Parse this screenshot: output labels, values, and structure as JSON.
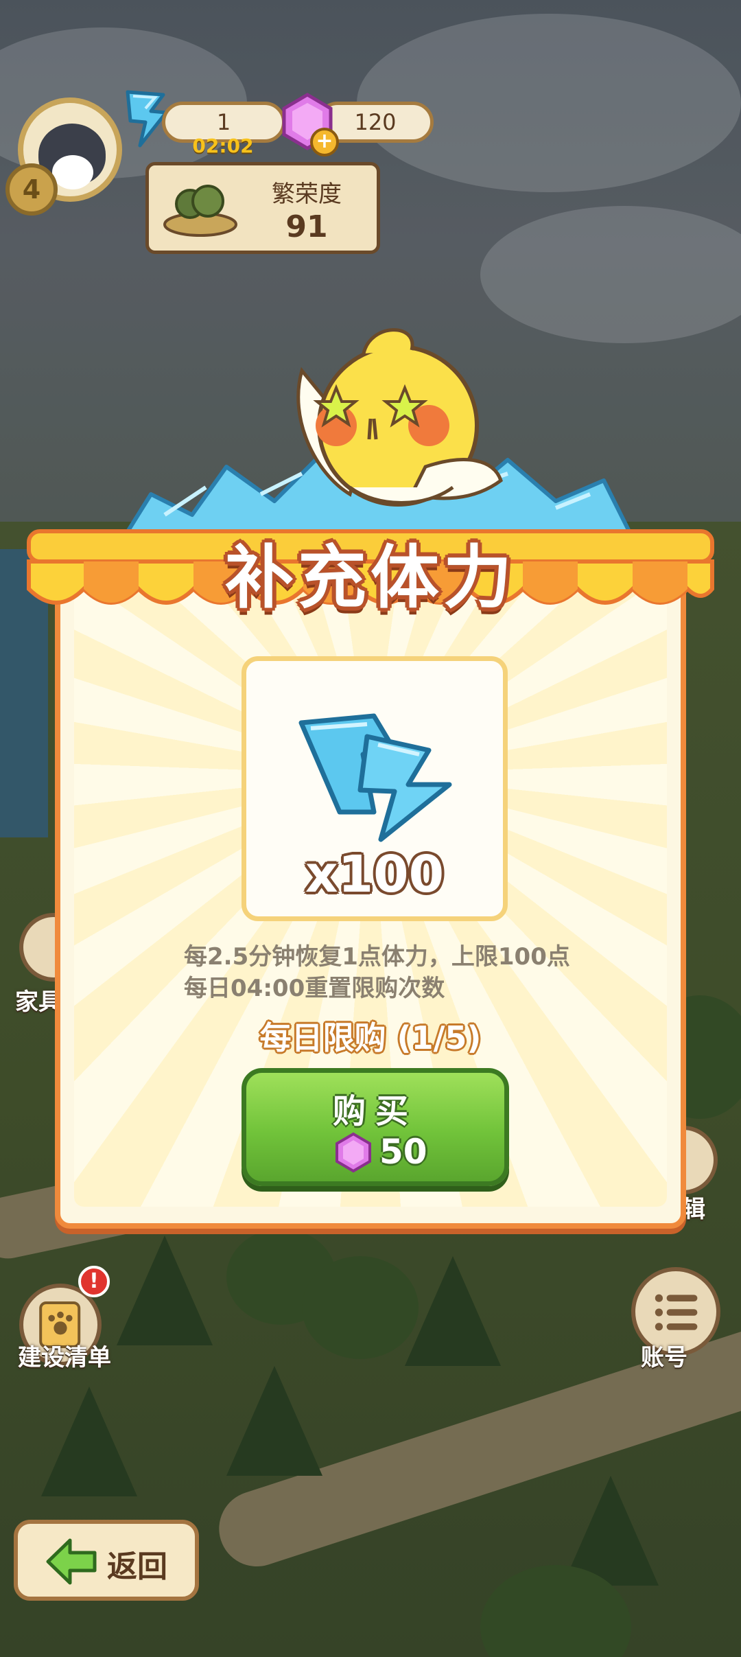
{
  "hud": {
    "level": "4",
    "energy": "1",
    "energy_timer": "02:02",
    "gems": "120",
    "prosperity_label": "繁荣度",
    "prosperity_value": "91"
  },
  "dialog": {
    "title": "补充体力",
    "item_quantity": "x100",
    "description_line1": "每2.5分钟恢复1点体力，上限100点",
    "description_line2": "每日04:00重置限购次数",
    "daily_limit": "每日限购 (1/5)",
    "buy_label": "购买",
    "price": "50"
  },
  "side_buttons": {
    "left_top_label": "家具",
    "build_list_label": "建设清单",
    "build_list_alert": "!",
    "right_top_label": "辑",
    "account_label": "账号"
  },
  "back_label": "返回",
  "colors": {
    "accent_orange": "#f08a3c",
    "button_green": "#71c33a",
    "energy_blue": "#5cc8ef",
    "gem_purple": "#e07be8"
  }
}
